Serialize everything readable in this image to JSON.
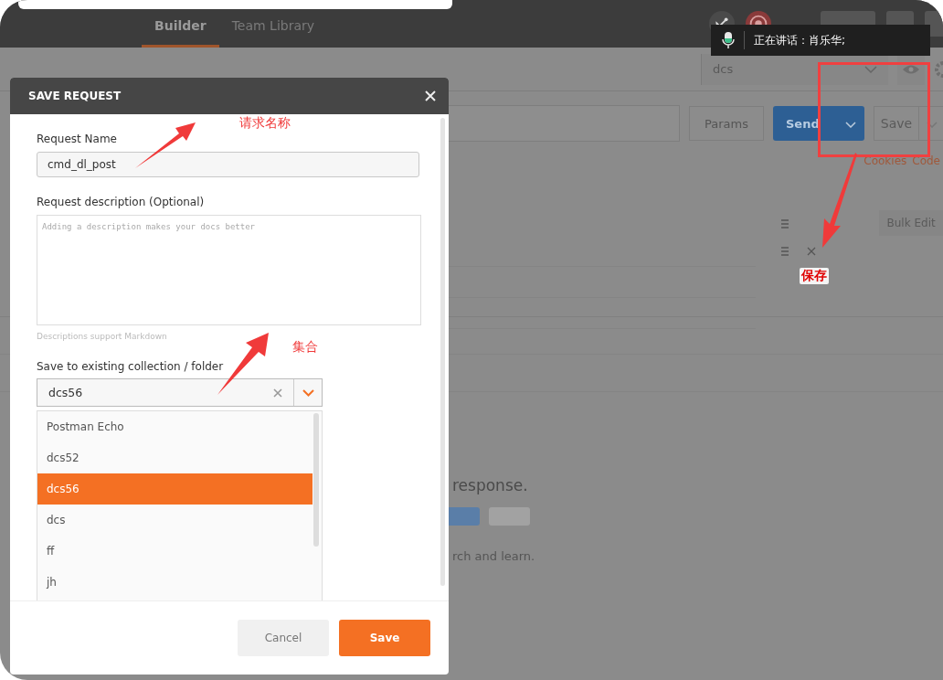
{
  "header": {
    "tabs": [
      {
        "label": "Builder",
        "selected": true
      },
      {
        "label": "Team Library",
        "selected": false
      }
    ]
  },
  "speaking_tooltip": {
    "text": "正在讲话：肖乐华;"
  },
  "environment": {
    "value": "dcs"
  },
  "request_bar": {
    "params": "Params",
    "send": "Send",
    "save": "Save"
  },
  "links": [
    "Cookies",
    "Code"
  ],
  "bulk_edit": "Bulk Edit",
  "response_area": {
    "message": "response.",
    "hint": "rch and learn."
  },
  "dialog": {
    "title": "SAVE REQUEST",
    "name_label": "Request Name",
    "name_value": "cmd_dl_post",
    "description_label": "Request description (Optional)",
    "description_placeholder": "Adding a description makes your docs better",
    "description_hint": "Descriptions support Markdown",
    "collection_label": "Save to existing collection / folder",
    "collection_value": "dcs56",
    "options": [
      {
        "label": "Postman Echo",
        "selected": false
      },
      {
        "label": "dcs52",
        "selected": false
      },
      {
        "label": "dcs56",
        "selected": true
      },
      {
        "label": "dcs",
        "selected": false
      },
      {
        "label": "ff",
        "selected": false
      },
      {
        "label": "jh",
        "selected": false
      }
    ],
    "cancel": "Cancel",
    "save": "Save"
  },
  "annotations": [
    "请求名称",
    "集合",
    "保存"
  ]
}
